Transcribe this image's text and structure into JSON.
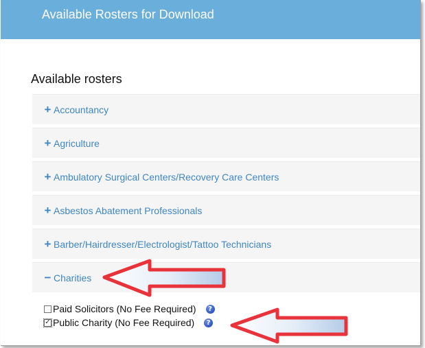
{
  "header": {
    "title": "Available Rosters for Download"
  },
  "section_title": "Available rosters",
  "accordion": [
    {
      "icon": "plus-icon",
      "symbol": "+",
      "label": "Accountancy",
      "expanded": false
    },
    {
      "icon": "plus-icon",
      "symbol": "+",
      "label": "Agriculture",
      "expanded": false
    },
    {
      "icon": "plus-icon",
      "symbol": "+",
      "label": "Ambulatory Surgical Centers/Recovery Care Centers",
      "expanded": false
    },
    {
      "icon": "plus-icon",
      "symbol": "+",
      "label": "Asbestos Abatement Professionals",
      "expanded": false
    },
    {
      "icon": "plus-icon",
      "symbol": "+",
      "label": "Barber/Hairdresser/Electrologist/Tattoo Technicians",
      "expanded": false
    },
    {
      "icon": "minus-icon",
      "symbol": "−",
      "label": "Charities",
      "expanded": true
    }
  ],
  "charities_options": [
    {
      "label": "Paid Solicitors (No Fee Required)",
      "checked": false,
      "help_icon": "question-icon",
      "help_symbol": "?"
    },
    {
      "label": "Public Charity (No Fee Required)",
      "checked": true,
      "help_icon": "question-icon",
      "help_symbol": "?"
    }
  ],
  "colors": {
    "header_bg": "#6aaedc",
    "link_blue": "#3f86c4",
    "accordion_bg": "#f5f5f5",
    "arrow_stroke": "#e8333b"
  }
}
